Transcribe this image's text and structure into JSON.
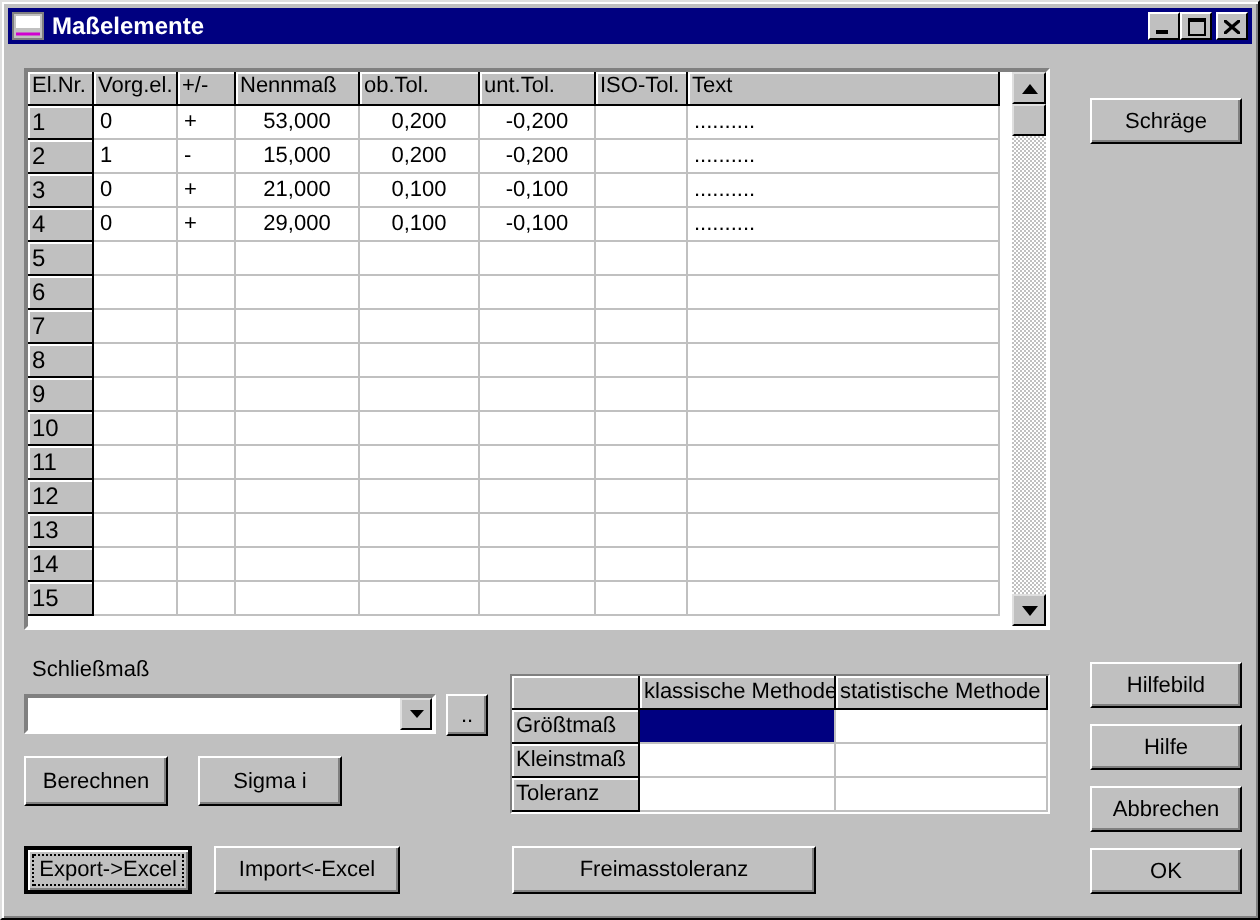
{
  "window": {
    "title": "Maßelemente"
  },
  "grid": {
    "columns": [
      "El.Nr.",
      "Vorg.el.",
      "+/-",
      "Nennmaß",
      "ob.Tol.",
      "unt.Tol.",
      "ISO-Tol.",
      "Text"
    ],
    "rows": [
      [
        "1",
        "0",
        "+",
        "53,000",
        "0,200",
        "-0,200",
        "",
        ".........."
      ],
      [
        "2",
        "1",
        "-",
        "15,000",
        "0,200",
        "-0,200",
        "",
        ".........."
      ],
      [
        "3",
        "0",
        "+",
        "21,000",
        "0,100",
        "-0,100",
        "",
        ".........."
      ],
      [
        "4",
        "0",
        "+",
        "29,000",
        "0,100",
        "-0,100",
        "",
        ".........."
      ],
      [
        "5",
        "",
        "",
        "",
        "",
        "",
        "",
        ""
      ],
      [
        "6",
        "",
        "",
        "",
        "",
        "",
        "",
        ""
      ],
      [
        "7",
        "",
        "",
        "",
        "",
        "",
        "",
        ""
      ],
      [
        "8",
        "",
        "",
        "",
        "",
        "",
        "",
        ""
      ],
      [
        "9",
        "",
        "",
        "",
        "",
        "",
        "",
        ""
      ],
      [
        "10",
        "",
        "",
        "",
        "",
        "",
        "",
        ""
      ],
      [
        "11",
        "",
        "",
        "",
        "",
        "",
        "",
        ""
      ],
      [
        "12",
        "",
        "",
        "",
        "",
        "",
        "",
        ""
      ],
      [
        "13",
        "",
        "",
        "",
        "",
        "",
        "",
        ""
      ],
      [
        "14",
        "",
        "",
        "",
        "",
        "",
        "",
        ""
      ],
      [
        "15",
        "",
        "",
        "",
        "",
        "",
        "",
        ""
      ]
    ]
  },
  "closing_dimension": {
    "label": "Schließmaß",
    "more_button": ".."
  },
  "calc_buttons": [
    {
      "label": "Berechnen",
      "focused": false
    },
    {
      "label": "Sigma i",
      "focused": false
    }
  ],
  "results": {
    "columns": [
      "klassische Methode",
      "statistische Methode"
    ],
    "rows": [
      {
        "label": "Größtmaß",
        "cells": [
          {
            "selected": true
          },
          {
            "selected": false
          }
        ]
      },
      {
        "label": "Kleinstmaß",
        "cells": [
          {
            "selected": false
          },
          {
            "selected": false
          }
        ]
      },
      {
        "label": "Toleranz",
        "cells": [
          {
            "selected": false
          },
          {
            "selected": false
          }
        ]
      }
    ]
  },
  "bottom_buttons": [
    {
      "label": "Export->Excel",
      "focused": true
    },
    {
      "label": "Import<-Excel",
      "focused": false
    },
    {
      "label": "Freimasstoleranz",
      "focused": false
    }
  ],
  "side_top_button": "Schräge",
  "side_buttons": [
    "Hilfebild",
    "Hilfe",
    "Abbrechen",
    "OK"
  ]
}
